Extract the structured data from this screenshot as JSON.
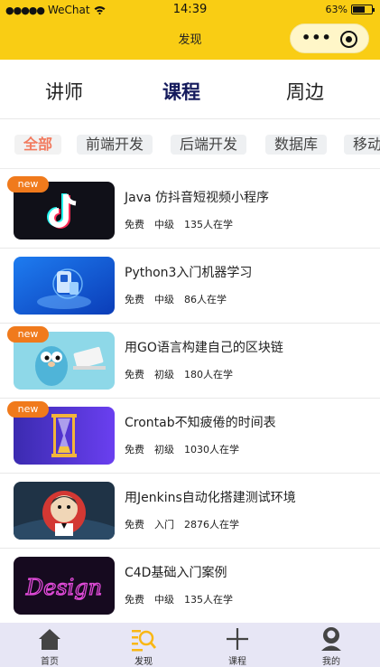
{
  "status_bar": {
    "signal": "●●●●●",
    "carrier": "WeChat",
    "time": "14:39",
    "battery": "63%",
    "battery_level": 0.63
  },
  "nav": {
    "title": "发现"
  },
  "main_tabs": [
    {
      "label": "讲师",
      "active": false
    },
    {
      "label": "课程",
      "active": true
    },
    {
      "label": "周边",
      "active": false
    }
  ],
  "categories": [
    {
      "label": "全部",
      "active": true
    },
    {
      "label": "前端开发",
      "active": false
    },
    {
      "label": "后端开发",
      "active": false
    },
    {
      "label": "数据库",
      "active": false
    },
    {
      "label": "移动",
      "active": false
    }
  ],
  "new_label": "new",
  "courses": [
    {
      "title": "Java 仿抖音短视频小程序",
      "price": "免费",
      "level": "中级",
      "learners": "135人在学",
      "is_new": true,
      "thumb_icon": "tiktok-logo-icon"
    },
    {
      "title": "Python3入门机器学习",
      "price": "免费",
      "level": "中级",
      "learners": "86人在学",
      "is_new": false,
      "thumb_icon": "robot-hand-icon"
    },
    {
      "title": "用GO语言构建自己的区块链",
      "price": "免费",
      "level": "初级",
      "learners": "180人在学",
      "is_new": true,
      "thumb_icon": "gopher-icon"
    },
    {
      "title": "Crontab不知疲倦的时间表",
      "price": "免费",
      "level": "初级",
      "learners": "1030人在学",
      "is_new": true,
      "thumb_icon": "hourglass-icon"
    },
    {
      "title": "用Jenkins自动化搭建测试环境",
      "price": "免费",
      "level": "入门",
      "learners": "2876人在学",
      "is_new": false,
      "thumb_icon": "jenkins-butler-icon"
    },
    {
      "title": "C4D基础入门案例",
      "price": "免费",
      "level": "中级",
      "learners": "135人在学",
      "is_new": false,
      "thumb_icon": "neon-design-icon"
    }
  ],
  "thumb_text": {
    "design": "Design"
  },
  "tabbar": [
    {
      "label": "首页",
      "icon": "home-icon",
      "active": false
    },
    {
      "label": "发现",
      "icon": "discover-icon",
      "active": true
    },
    {
      "label": "课程",
      "icon": "plus-icon",
      "active": false
    },
    {
      "label": "我的",
      "icon": "user-icon",
      "active": false
    }
  ],
  "colors": {
    "accent": "#f9cd14",
    "new_tag": "#f07a1c",
    "active_category": "#f27a5e",
    "active_tab": "#141a5c",
    "tabbar_bg": "#e7e6f5"
  }
}
